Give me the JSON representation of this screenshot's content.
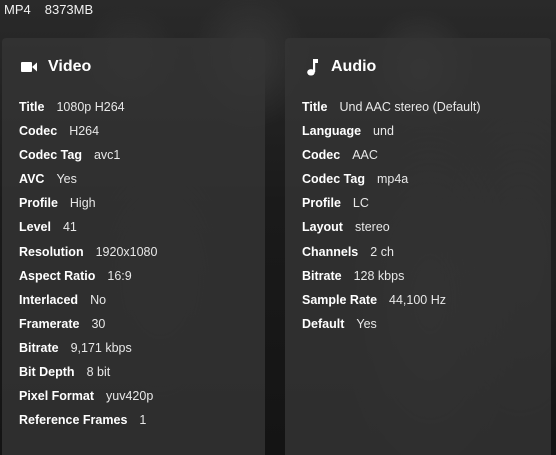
{
  "topbar": {
    "container": "MP4",
    "size": "8373MB"
  },
  "video": {
    "title": "Video",
    "icon": "videocam-icon",
    "rows": [
      {
        "label": "Title",
        "value": "1080p H264"
      },
      {
        "label": "Codec",
        "value": "H264"
      },
      {
        "label": "Codec Tag",
        "value": "avc1"
      },
      {
        "label": "AVC",
        "value": "Yes"
      },
      {
        "label": "Profile",
        "value": "High"
      },
      {
        "label": "Level",
        "value": "41"
      },
      {
        "label": "Resolution",
        "value": "1920x1080"
      },
      {
        "label": "Aspect Ratio",
        "value": "16:9"
      },
      {
        "label": "Interlaced",
        "value": "No"
      },
      {
        "label": "Framerate",
        "value": "30"
      },
      {
        "label": "Bitrate",
        "value": "9,171 kbps"
      },
      {
        "label": "Bit Depth",
        "value": "8 bit"
      },
      {
        "label": "Pixel Format",
        "value": "yuv420p"
      },
      {
        "label": "Reference Frames",
        "value": "1"
      }
    ]
  },
  "audio": {
    "title": "Audio",
    "icon": "music-note-icon",
    "rows": [
      {
        "label": "Title",
        "value": "Und AAC stereo (Default)"
      },
      {
        "label": "Language",
        "value": "und"
      },
      {
        "label": "Codec",
        "value": "AAC"
      },
      {
        "label": "Codec Tag",
        "value": "mp4a"
      },
      {
        "label": "Profile",
        "value": "LC"
      },
      {
        "label": "Layout",
        "value": "stereo"
      },
      {
        "label": "Channels",
        "value": "2 ch"
      },
      {
        "label": "Bitrate",
        "value": "128 kbps"
      },
      {
        "label": "Sample Rate",
        "value": "44,100 Hz"
      },
      {
        "label": "Default",
        "value": "Yes"
      }
    ]
  }
}
